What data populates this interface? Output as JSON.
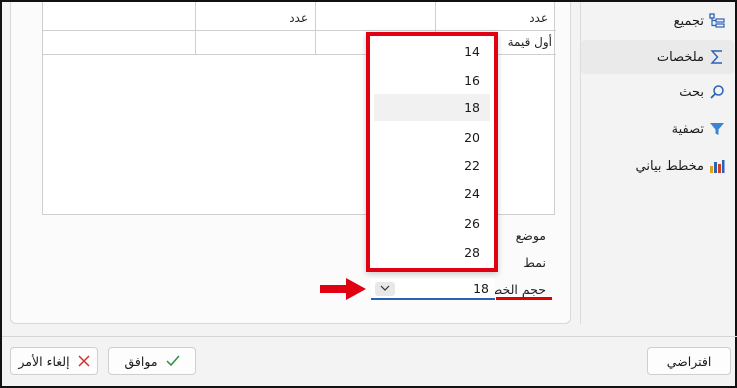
{
  "grid": {
    "header": [
      "عدد",
      "عدد"
    ],
    "row1_label": "أول قيمة"
  },
  "labels": {
    "position": "موضع",
    "style": "نمط",
    "font_size": "حجم الخط"
  },
  "font_size_field": {
    "value": "18"
  },
  "dropdown": {
    "options": [
      "14",
      "16",
      "18",
      "20",
      "22",
      "24",
      "26",
      "28"
    ],
    "selected": "18"
  },
  "sidebar": {
    "items": [
      {
        "label": "تجميع",
        "icon": "grouping-icon"
      },
      {
        "label": "ملخصات",
        "icon": "sigma-icon"
      },
      {
        "label": "بحث",
        "icon": "search-icon"
      },
      {
        "label": "تصفية",
        "icon": "filter-icon"
      },
      {
        "label": "مخطط بياني",
        "icon": "bar-chart-icon"
      }
    ]
  },
  "buttons": {
    "cancel": "إلغاء الأمر",
    "ok": "موافق",
    "default": "افتراضي"
  },
  "colors": {
    "highlight": "#e00012",
    "accent": "#2a62b8"
  }
}
